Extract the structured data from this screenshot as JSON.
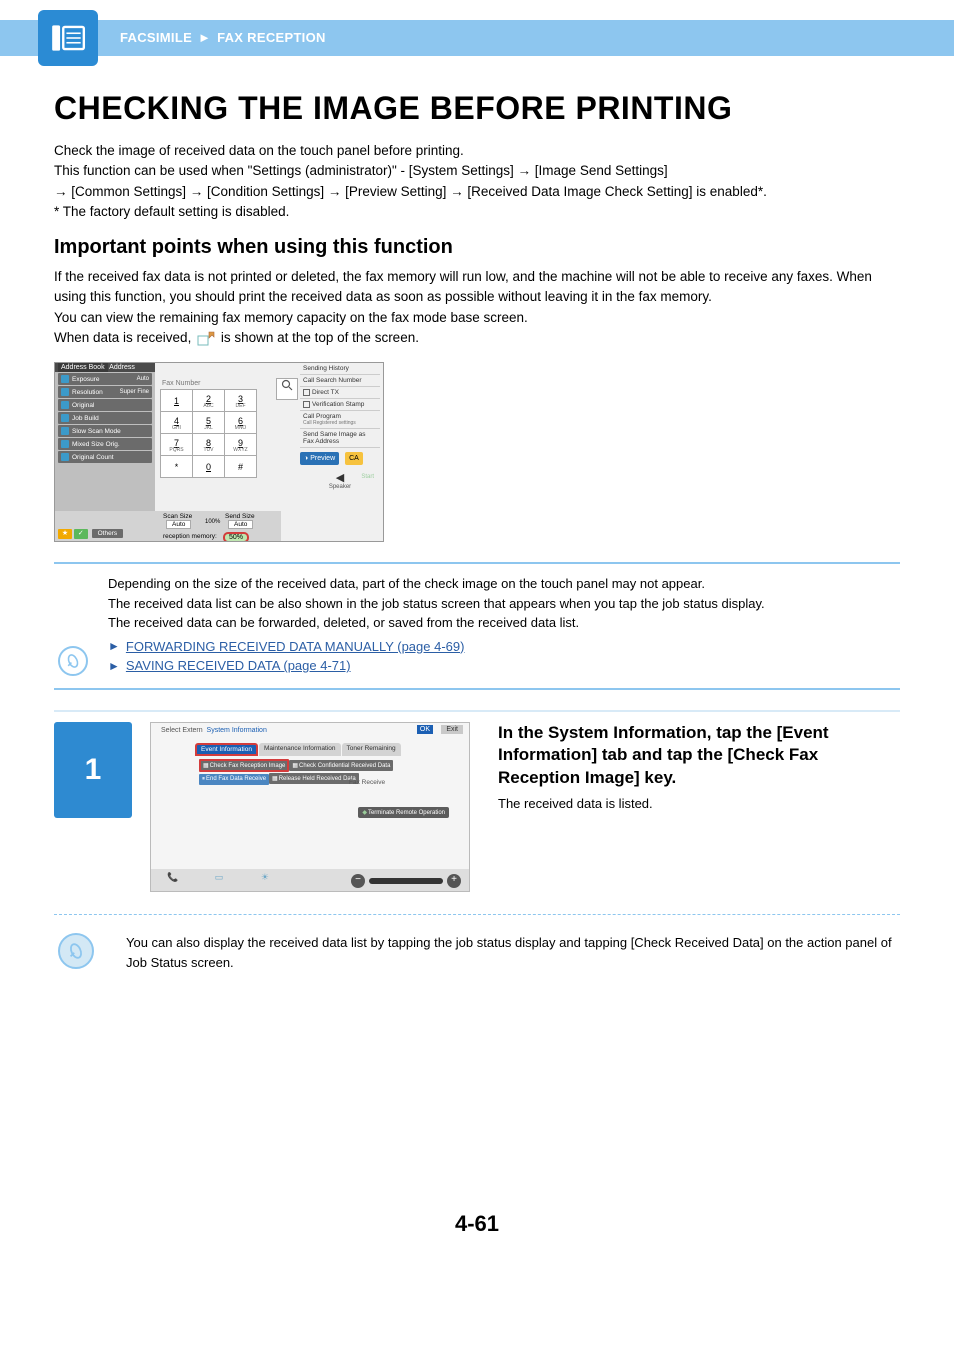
{
  "breadcrumb": {
    "a": "FACSIMILE",
    "sep": "►",
    "b": "FAX RECEPTION"
  },
  "h1": "CHECKING THE IMAGE BEFORE PRINTING",
  "intro": {
    "p1": "Check the image of received data on the touch panel before printing.",
    "p2": "This function can be used when \"Settings (administrator)\" - [System Settings] → [Image Send Settings]",
    "p3": "→ [Common Settings] → [Condition Settings] → [Preview Setting] → [Received Data Image Check Setting] is enabled*.",
    "p4": "* The factory default setting is disabled."
  },
  "h2": "Important points when using this function",
  "body": {
    "p1": "If the received fax data is not printed or deleted, the fax memory will run low, and the machine will not be able to receive any faxes. When using this function, you should print the received data as soon as possible without leaving it in the fax memory.",
    "p2": "You can view the remaining fax memory capacity on the fax mode base screen.",
    "p3a": "When data is received, ",
    "p3b": " is shown at the top of the screen."
  },
  "screenshot1": {
    "left_header_a": "Address Book",
    "left_header_b": "Address",
    "rows": [
      {
        "label": "Exposure",
        "value": "Auto"
      },
      {
        "label": "Resolution",
        "value": "Super Fine"
      },
      {
        "label": "Original",
        "value": ""
      },
      {
        "label": "Job Build",
        "value": ""
      },
      {
        "label": "Slow Scan Mode",
        "value": ""
      },
      {
        "label": "Mixed Size Orig.",
        "value": ""
      },
      {
        "label": "Original Count",
        "value": ""
      }
    ],
    "faxnum": "Fax Number",
    "keypad": [
      [
        "1",
        ""
      ],
      [
        "2",
        "ABC"
      ],
      [
        "3",
        "DEF"
      ],
      [
        "4",
        "GHI"
      ],
      [
        "5",
        "JKL"
      ],
      [
        "6",
        "MNO"
      ],
      [
        "7",
        "PQRS"
      ],
      [
        "8",
        "TUV"
      ],
      [
        "9",
        "WXYZ"
      ],
      [
        "*",
        ""
      ],
      [
        "0",
        ""
      ],
      [
        "#",
        ""
      ]
    ],
    "right": {
      "sendhist": "Sending History",
      "callsearch": "Call Search Number",
      "directtx": "Direct TX",
      "verstamp": "Verification Stamp",
      "callprog": "Call Program",
      "callreg": "Call Registered settings",
      "sendsame": "Send Same Image as Fax Address",
      "preview": "Preview",
      "ca": "CA",
      "speaker": "Speaker",
      "start": "Start"
    },
    "bottom": {
      "others": "Others",
      "scansize": "Scan Size",
      "sendsize": "Send Size",
      "auto": "Auto",
      "pct": "100%",
      "recmem": "reception memory:",
      "recval": "50%"
    }
  },
  "note1": {
    "l1": "Depending on the size of the received data, part of the check image on the touch panel may not appear.",
    "l2": "The received data list can be also shown in the job status screen that appears when you tap the job status display.",
    "l3": "The received data can be forwarded, deleted, or saved from the received data list.",
    "link1": "FORWARDING RECEIVED DATA MANUALLY (page 4-69)",
    "link2": "SAVING RECEIVED DATA (page 4-71)",
    "arrow": "►"
  },
  "step": {
    "num": "1",
    "img": {
      "selextern": "Select Extern",
      "sysinfo": "System Information",
      "ok": "OK",
      "exit": "Exit",
      "tab_event": "Event Information",
      "tab_maint": "Maintenance Information",
      "tab_toner": "Toner Remaining",
      "btn_checkfax": "Check Fax Reception Image",
      "btn_checkconf": "Check Confidential Received Data",
      "btn_endfax": "End Fax Data Receive",
      "btn_release": "Release Held Received Data",
      "faxreceive": "Fax Receive",
      "terminate": "Terminate Remote Operation"
    },
    "h3": "In the System Information, tap the [Event Information] tab and tap the [Check Fax Reception Image] key.",
    "p": "The received data is listed."
  },
  "tip": "You can also display the received data list by tapping the job status display and tapping [Check Received Data] on the action panel of Job Status screen.",
  "pagenum": "4-61"
}
